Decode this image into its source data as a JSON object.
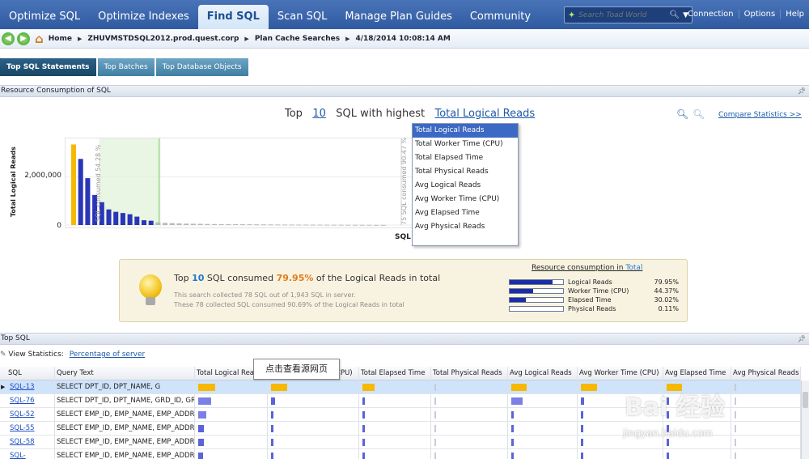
{
  "nav": {
    "tabs": [
      {
        "label": "Optimize SQL"
      },
      {
        "label": "Optimize Indexes"
      },
      {
        "label": "Find SQL"
      },
      {
        "label": "Scan SQL"
      },
      {
        "label": "Manage Plan Guides"
      },
      {
        "label": "Community"
      }
    ],
    "active_tab": "Find SQL",
    "search_placeholder": "Search Toad World",
    "links": {
      "connection": "Connection",
      "options": "Options",
      "help": "Help"
    }
  },
  "breadcrumb": {
    "home": "Home",
    "server": "ZHUVMSTDSQL2012.prod.quest.corp",
    "page": "Plan Cache Searches",
    "timestamp": "4/18/2014 10:08:14 AM"
  },
  "subtabs": [
    "Top SQL Statements",
    "Top Batches",
    "Top Database Objects"
  ],
  "resource_panel": {
    "title": "Resource Consumption of SQL",
    "headline_prefix": "Top",
    "top_n": "10",
    "headline_mid": "SQL with highest",
    "metric": "Total Logical Reads",
    "compare_link": "Compare Statistics >>",
    "y_axis_label": "Total Logical Reads",
    "y_tick_top": "2,000,000",
    "y_tick_zero": "0",
    "x_axis_label": "SQL",
    "overlay_text_left": "SQL consumed 54.28 %",
    "overlay_text_right": "75 SQL consumed 90.47 %"
  },
  "metric_dropdown": {
    "options": [
      "Total Logical Reads",
      "Total Worker Time (CPU)",
      "Total Elapsed Time",
      "Total Physical Reads",
      "Avg Logical Reads",
      "Avg Worker Time (CPU)",
      "Avg Elapsed Time",
      "Avg Physical Reads"
    ],
    "selected": "Total Logical Reads"
  },
  "chart_data": {
    "type": "bar",
    "title": "",
    "xlabel": "SQL",
    "ylabel": "Total Logical Reads",
    "ylim": [
      0,
      3500000
    ],
    "ticks": [
      0,
      2000000
    ],
    "values": [
      3350000,
      2750000,
      1950000,
      1250000,
      950000,
      650000,
      550000,
      500000,
      450000,
      350000,
      200000,
      180000,
      110000,
      90000,
      80000,
      70000,
      60000,
      55000,
      50000,
      45000,
      40000,
      38000,
      36000,
      34000,
      32000,
      30000,
      28000,
      26000,
      24000,
      22000,
      20000,
      19000,
      18000,
      17000,
      16000,
      15000,
      14000,
      13000,
      12000,
      11000,
      10000,
      9000,
      8000,
      7000,
      6000
    ],
    "highlight_index": 0,
    "colors": {
      "highlight": "#f7b800",
      "top": "#2a35b8",
      "rest": "#b9b9b9"
    }
  },
  "summary": {
    "line_prefix": "Top",
    "count": "10",
    "line_mid": "SQL consumed",
    "percent": "79.95%",
    "line_suffix": "of the Logical Reads in total",
    "sub1": "This search collected 78 SQL out of 1,943 SQL in server.",
    "sub2": "These 78 collected SQL consumed 90.69% of the Logical Reads in total",
    "rc_title": "Resource consumption in",
    "rc_title_link": "Total",
    "rc_rows": [
      {
        "label": "Logical Reads",
        "value": "79.95%",
        "fill": 0.7995
      },
      {
        "label": "Worker Time (CPU)",
        "value": "44.37%",
        "fill": 0.4437
      },
      {
        "label": "Elapsed Time",
        "value": "30.02%",
        "fill": 0.3002
      },
      {
        "label": "Physical Reads",
        "value": "0.11%",
        "fill": 0.0011
      }
    ]
  },
  "top_sql": {
    "panel_title": "Top SQL",
    "view_stats_label": "View Statistics:",
    "view_stats_link": "Percentage of server",
    "columns": [
      "SQL",
      "Query Text",
      "Total Logical Reads",
      "Total Worker Time (CPU)",
      "Total Elapsed Time",
      "Total Physical Reads",
      "Avg Logical Reads",
      "Avg Worker Time (CPU)",
      "Avg Elapsed Time",
      "Avg Physical Reads"
    ],
    "rows": [
      {
        "id": "SQL-13",
        "query": "SELECT DPT_ID,        DPT_NAME,        G",
        "bars": [
          0.95,
          0.9,
          0.7,
          0.0,
          0.85,
          0.9,
          0.85,
          0.0
        ]
      },
      {
        "id": "SQL-76",
        "query": "SELECT DPT_ID, DPT_NAME, GRD_ID, GRD_N",
        "bars": [
          0.72,
          0.22,
          0.12,
          0.0,
          0.62,
          0.2,
          0.12,
          0.0
        ]
      },
      {
        "id": "SQL-52",
        "query": "SELECT EMP_ID, EMP_NAME, EMP_ADDRESS,",
        "bars": [
          0.45,
          0.1,
          0.05,
          0.0,
          0.1,
          0.05,
          0.05,
          0.0
        ]
      },
      {
        "id": "SQL-55",
        "query": "SELECT EMP_ID, EMP_NAME, EMP_ADDRESS,",
        "bars": [
          0.3,
          0.1,
          0.05,
          0.0,
          0.08,
          0.05,
          0.05,
          0.0
        ]
      },
      {
        "id": "SQL-58",
        "query": "SELECT EMP_ID, EMP_NAME, EMP_ADDRESS,",
        "bars": [
          0.3,
          0.1,
          0.05,
          0.0,
          0.08,
          0.05,
          0.05,
          0.0
        ]
      },
      {
        "id": "SQL-",
        "query": "SELECT EMP_ID, EMP_NAME, EMP_ADDRESS,",
        "bars": [
          0.25,
          0.08,
          0.05,
          0.0,
          0.06,
          0.05,
          0.05,
          0.0
        ]
      }
    ],
    "tooltip": "点击查看源网页"
  },
  "watermark": {
    "logo": "Bai 经验",
    "url": "jingyan.baidu.com"
  }
}
